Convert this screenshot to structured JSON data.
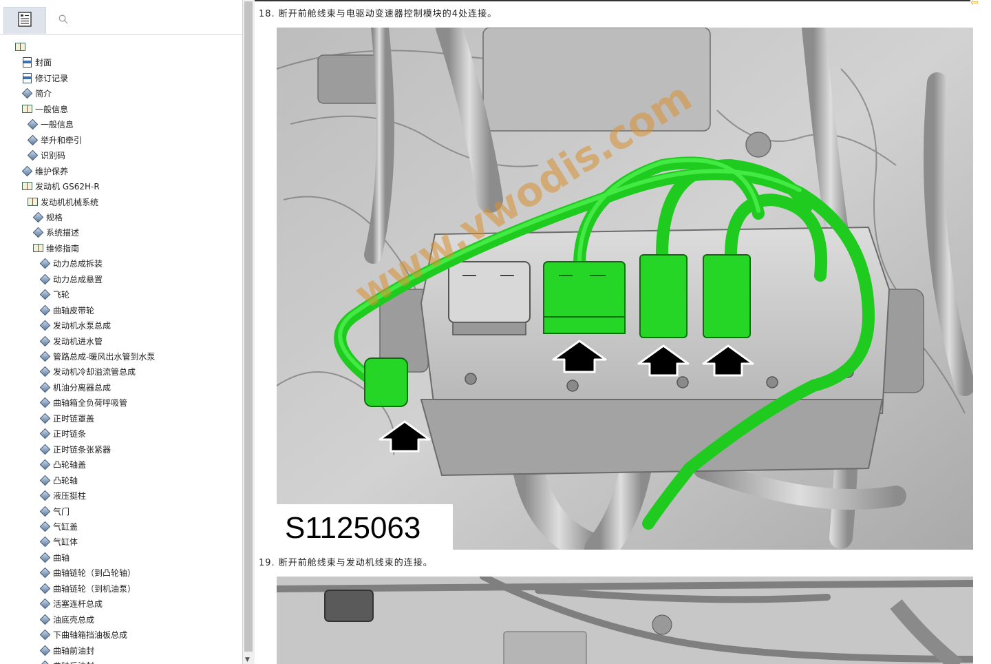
{
  "toc": {
    "tabs": {
      "bookmarks_icon": "bookmark-list-icon",
      "search_icon": "search-icon"
    },
    "items": [
      {
        "label": "",
        "icon": "book"
      },
      {
        "label": "封面",
        "icon": "doc"
      },
      {
        "label": "修订记录",
        "icon": "doc"
      },
      {
        "label": "简介",
        "icon": "diamond"
      },
      {
        "label": "一般信息",
        "icon": "book"
      },
      {
        "label": "一般信息",
        "icon": "diamond"
      },
      {
        "label": "举升和牵引",
        "icon": "diamond"
      },
      {
        "label": "识别码",
        "icon": "diamond"
      },
      {
        "label": "维护保养",
        "icon": "diamond"
      },
      {
        "label": "发动机 GS62H-R",
        "icon": "book"
      },
      {
        "label": "发动机机械系统",
        "icon": "book"
      },
      {
        "label": "规格",
        "icon": "diamond"
      },
      {
        "label": "系统描述",
        "icon": "diamond"
      },
      {
        "label": "维修指南",
        "icon": "book"
      },
      {
        "label": "动力总成拆装",
        "icon": "diamond"
      },
      {
        "label": "动力总成悬置",
        "icon": "diamond"
      },
      {
        "label": "飞轮",
        "icon": "diamond"
      },
      {
        "label": "曲轴皮带轮",
        "icon": "diamond"
      },
      {
        "label": "发动机水泵总成",
        "icon": "diamond"
      },
      {
        "label": "发动机进水管",
        "icon": "diamond"
      },
      {
        "label": "管路总成-暖风出水管到水泵",
        "icon": "diamond"
      },
      {
        "label": "发动机冷却溢流管总成",
        "icon": "diamond"
      },
      {
        "label": "机油分离器总成",
        "icon": "diamond"
      },
      {
        "label": "曲轴箱全负荷呼吸管",
        "icon": "diamond"
      },
      {
        "label": "正时链罩盖",
        "icon": "diamond"
      },
      {
        "label": "正时链条",
        "icon": "diamond"
      },
      {
        "label": "正时链条张紧器",
        "icon": "diamond"
      },
      {
        "label": "凸轮轴盖",
        "icon": "diamond"
      },
      {
        "label": "凸轮轴",
        "icon": "diamond"
      },
      {
        "label": "液压挺柱",
        "icon": "diamond"
      },
      {
        "label": "气门",
        "icon": "diamond"
      },
      {
        "label": "气缸盖",
        "icon": "diamond"
      },
      {
        "label": "气缸体",
        "icon": "diamond"
      },
      {
        "label": "曲轴",
        "icon": "diamond"
      },
      {
        "label": "曲轴链轮（到凸轮轴）",
        "icon": "diamond"
      },
      {
        "label": "曲轴链轮（到机油泵）",
        "icon": "diamond"
      },
      {
        "label": "活塞连杆总成",
        "icon": "diamond"
      },
      {
        "label": "油底壳总成",
        "icon": "diamond"
      },
      {
        "label": "下曲轴箱挡油板总成",
        "icon": "diamond"
      },
      {
        "label": "曲轴前油封",
        "icon": "diamond"
      },
      {
        "label": "曲轴后油封",
        "icon": "diamond"
      }
    ]
  },
  "document": {
    "step18": "18. 断开前舱线束与电驱动变速器控制模块的4处连接。",
    "step19": "19. 断开前舱线束与发动机线束的连接。",
    "figure1": {
      "code": "S1125063",
      "watermark": "www.vwodis.com"
    },
    "colors": {
      "harness": "#22dd22",
      "arrow": "#000000",
      "engine": "#c8c8c8",
      "watermark": "#d89030"
    }
  }
}
